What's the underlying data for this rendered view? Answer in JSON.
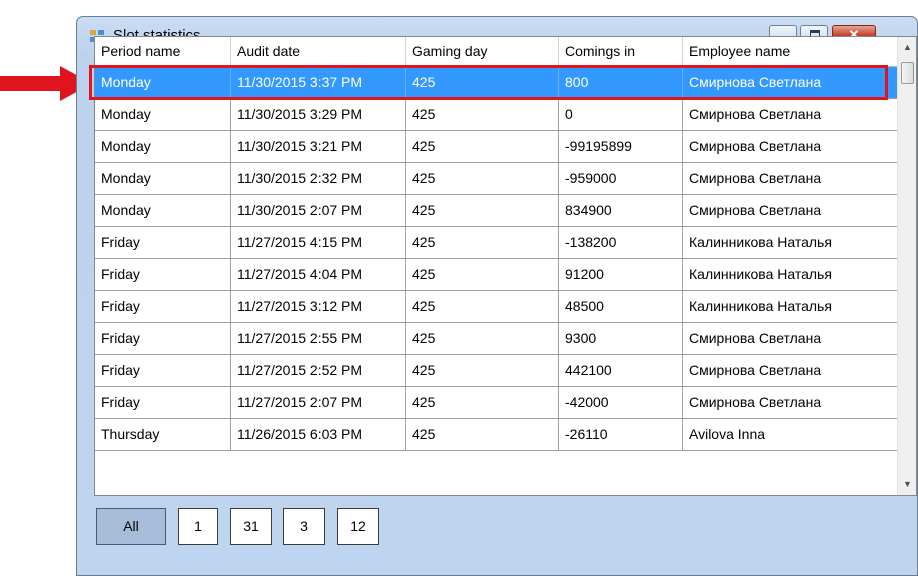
{
  "window": {
    "title": "Slot statistics"
  },
  "controls": {
    "minimize": "minimize",
    "maximize": "maximize",
    "close": "✕"
  },
  "grid": {
    "columns": [
      "Period name",
      "Audit date",
      "Gaming day",
      "Comings in",
      "Employee name"
    ],
    "rows": [
      [
        "Monday",
        "11/30/2015 3:37 PM",
        "425",
        "800",
        "Смирнова Светлана"
      ],
      [
        "Monday",
        "11/30/2015 3:29 PM",
        "425",
        "0",
        "Смирнова Светлана"
      ],
      [
        "Monday",
        "11/30/2015 3:21 PM",
        "425",
        "-99195899",
        "Смирнова Светлана"
      ],
      [
        "Monday",
        "11/30/2015 2:32 PM",
        "425",
        "-959000",
        "Смирнова Светлана"
      ],
      [
        "Monday",
        "11/30/2015 2:07 PM",
        "425",
        "834900",
        "Смирнова Светлана"
      ],
      [
        "Friday",
        "11/27/2015 4:15 PM",
        "425",
        "-138200",
        "Калинникова Наталья"
      ],
      [
        "Friday",
        "11/27/2015 4:04 PM",
        "425",
        "91200",
        "Калинникова Наталья"
      ],
      [
        "Friday",
        "11/27/2015 3:12 PM",
        "425",
        "48500",
        "Калинникова Наталья"
      ],
      [
        "Friday",
        "11/27/2015 2:55 PM",
        "425",
        "9300",
        "Смирнова Светлана"
      ],
      [
        "Friday",
        "11/27/2015 2:52 PM",
        "425",
        "442100",
        "Смирнова Светлана"
      ],
      [
        "Friday",
        "11/27/2015 2:07 PM",
        "425",
        "-42000",
        "Смирнова Светлана"
      ],
      [
        "Thursday",
        "11/26/2015 6:03 PM",
        "425",
        "-26110",
        "Avilova Inna"
      ]
    ],
    "selected_index": 0
  },
  "filters": [
    "All",
    "1",
    "31",
    "3",
    "12"
  ],
  "colors": {
    "selection": "#3399ff",
    "highlight": "#e0141e",
    "active_filter": "#a6bcd8"
  }
}
